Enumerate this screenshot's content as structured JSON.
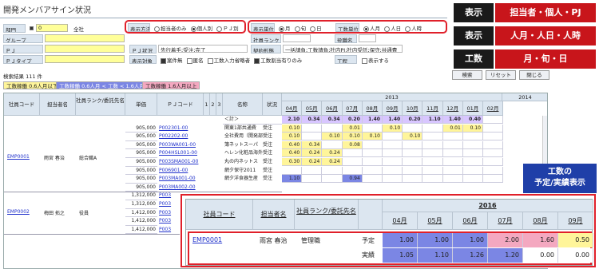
{
  "window": {
    "title": "開発メンバアサイン状況"
  },
  "filters": {
    "bumon_label": "部門",
    "bumon_code": "0",
    "bumon_name": "全社",
    "group_label": "グループ",
    "pj_label": "ＰＪ",
    "pjtype_label": "ＰＪタイプ",
    "display_method_label": "表示方法",
    "display_method_options": [
      "担当者のみ",
      "個人別",
      "ＰＪ別"
    ],
    "display_method_selected": "個人別",
    "display_unit_label": "表示単位",
    "display_unit_options": [
      "月",
      "旬",
      "日"
    ],
    "display_unit_selected": "月",
    "effort_unit_label": "工数単位",
    "effort_unit_options": [
      "人月",
      "人日",
      "人時"
    ],
    "effort_unit_selected": "人月",
    "rank_label": "社員ランク",
    "position_label": "役職名",
    "pj_status_label": "ＰＪ状況",
    "pj_status_value": "先行着手;受注;完了",
    "contract_label": "契約形態",
    "contract_value": "一括請負;工数請負;社内PJ;社内受託;保守;共通費",
    "target_label": "表示対象",
    "target_options": [
      "案件無",
      "匿名",
      "工数入力省略者",
      "工数割当有りのみ"
    ],
    "target_checked": [
      "工数割当有りのみ"
    ],
    "process_label": "工程",
    "process_display": "表示する"
  },
  "results": {
    "label": "検索結果",
    "count": "111 件"
  },
  "buttons": {
    "search": "検索",
    "reset": "リセット",
    "close": "閉じる"
  },
  "legend": [
    "工数稼働 0.6人月以下",
    "工数稼働 0.6人月 < 工数 < 1.6人月",
    "工数稼働 1.6人月以上"
  ],
  "grid": {
    "headers": [
      "社員コード",
      "担当者名",
      "社員ランク/委託先名",
      "単価",
      "ＰＪコード",
      "1",
      "2",
      "3",
      "名称",
      "状況"
    ],
    "year1": "2013",
    "year2": "2014",
    "months": [
      "04月",
      "05月",
      "06月",
      "07月",
      "08月",
      "09月",
      "10月",
      "11月",
      "12月",
      "01月",
      "02月"
    ],
    "total_row": {
      "label": "＜計＞",
      "values": [
        "2.10",
        "0.34",
        "0.34",
        "0.20",
        "1.40",
        "1.40",
        "0.20",
        "1.10",
        "1.40",
        "0.40",
        ""
      ]
    },
    "employees": [
      {
        "code": "EMP0001",
        "name": "雨宮 春治",
        "rank": "総合職A",
        "rows": [
          {
            "price": "905,000",
            "pj": "P002301-00",
            "title": "関東1部共通費",
            "status": "受注",
            "values": [
              "0.10",
              "",
              "",
              "0.01",
              "",
              "0.10",
              "",
              "",
              "0.01",
              "0.10",
              ""
            ]
          },
          {
            "price": "905,000",
            "pj": "P002202-00",
            "title": "全社費用（開発部）",
            "status": "受注",
            "values": [
              "0.10",
              "",
              "0.10",
              "0.10",
              "0.10",
              "",
              "0.10",
              "",
              "",
              "",
              ""
            ]
          },
          {
            "price": "905,000",
            "pj": "P003WA001-00",
            "title": "簿ネットスーパ",
            "status": "受注",
            "values": [
              "0.40",
              "0.34",
              "",
              "0.08",
              "",
              "",
              "",
              "",
              "",
              "",
              ""
            ]
          },
          {
            "price": "905,000",
            "pj": "P004HSL001-00",
            "title": "ヘレン化粧品海外",
            "status": "受注",
            "values": [
              "0.40",
              "0.24",
              "0.24",
              "",
              "",
              "",
              "",
              "",
              "",
              "",
              ""
            ]
          },
          {
            "price": "905,000",
            "pj": "P003SMA001-00",
            "title": "丸の内ネットス",
            "status": "受注",
            "values": [
              "0.30",
              "0.24",
              "0.24",
              "",
              "",
              "",
              "",
              "",
              "",
              "",
              ""
            ]
          },
          {
            "price": "905,000",
            "pj": "P006901-00",
            "title": "網夕保守2011",
            "status": "受注",
            "values": [
              "",
              "",
              "",
              "",
              "",
              "",
              "",
              "",
              "",
              "",
              ""
            ]
          },
          {
            "price": "905,000",
            "pj": "P003MA001-00",
            "title": "網夕洋食器生産",
            "status": "受注",
            "values": [
              "1.10",
              "",
              "",
              "0.94",
              "",
              "",
              "",
              "",
              "",
              "",
              ""
            ]
          },
          {
            "price": "905,000",
            "pj": "P003MA002-00",
            "title": "",
            "status": "",
            "values": []
          }
        ]
      },
      {
        "code": "EMP0002",
        "name": "梅田 拓之",
        "rank": "役員",
        "rows": [
          {
            "price": "1,312,000",
            "pj": "P003",
            "title": "",
            "status": "",
            "values": []
          },
          {
            "price": "1,312,000",
            "pj": "P003",
            "title": "",
            "status": "",
            "values": []
          },
          {
            "price": "1,412,000",
            "pj": "P003",
            "title": "",
            "status": "",
            "values": []
          },
          {
            "price": "1,412,000",
            "pj": "P003",
            "title": "",
            "status": "",
            "values": []
          },
          {
            "price": "1,412,000",
            "pj": "P003",
            "title": "",
            "status": "",
            "values": []
          }
        ]
      }
    ]
  },
  "badges": [
    {
      "label": "表示",
      "value": "担当者・個人・PJ"
    },
    {
      "label": "表示",
      "value": "人月・人日・人時"
    },
    {
      "label": "工数",
      "value": "月・旬・日"
    }
  ],
  "callout": {
    "line1": "工数の",
    "line2": "予定/実績表示"
  },
  "zoom": {
    "headers": [
      "社員コード",
      "担当者名",
      "社員ランク/委託先名"
    ],
    "year": "2016",
    "months": [
      "04月",
      "05月",
      "06月",
      "07月",
      "08月",
      "09月"
    ],
    "emp_code": "EMP0001",
    "emp_name": "雨宮 春治",
    "emp_rank": "管理職",
    "plan_label": "予定",
    "actual_label": "実績",
    "plan": [
      "1.00",
      "1.00",
      "1.00",
      "2.00",
      "1.60",
      "0.50"
    ],
    "actual": [
      "1.05",
      "1.10",
      "1.26",
      "1.20",
      "0.00",
      "0.00"
    ],
    "colors": {
      "blue": "#7b86e4",
      "pink": "#f4a8c0",
      "yellow": "#fff59a",
      "highlight_green": "#e8f8b0"
    }
  }
}
